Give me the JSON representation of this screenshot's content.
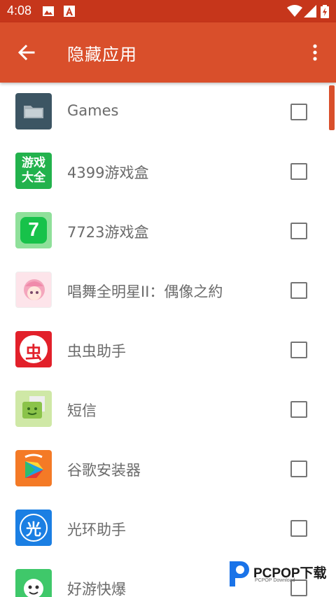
{
  "status_bar": {
    "time": "4:08",
    "icons": [
      "image-icon",
      "keyboard-a-icon",
      "wifi-icon",
      "signal-icon",
      "battery-icon"
    ]
  },
  "toolbar": {
    "title": "隐藏应用",
    "back_icon": "arrow-back-icon",
    "menu_icon": "more-vert-icon",
    "color": "#d94f2b",
    "status_color": "#c6361b"
  },
  "apps": [
    {
      "name": "Games",
      "checked": false,
      "icon": "folder-icon"
    },
    {
      "name": "4399游戏盒",
      "checked": false,
      "icon": "4399-icon",
      "icon_text": "游戏大全"
    },
    {
      "name": "7723游戏盒",
      "checked": false,
      "icon": "7723-icon",
      "icon_text": "7"
    },
    {
      "name": "唱舞全明星II：偶像之約",
      "checked": false,
      "icon": "anime-girl-icon"
    },
    {
      "name": "虫虫助手",
      "checked": false,
      "icon": "chongchong-icon",
      "icon_text": "虫"
    },
    {
      "name": "短信",
      "checked": false,
      "icon": "sms-icon"
    },
    {
      "name": "谷歌安装器",
      "checked": false,
      "icon": "google-installer-icon"
    },
    {
      "name": "光环助手",
      "checked": false,
      "icon": "guanghuan-icon",
      "icon_text": "光"
    },
    {
      "name": "好游快爆",
      "checked": false,
      "icon": "haoyou-icon"
    }
  ],
  "watermark": {
    "text": "PCPOP下载",
    "sub": "PCPOP Download"
  }
}
